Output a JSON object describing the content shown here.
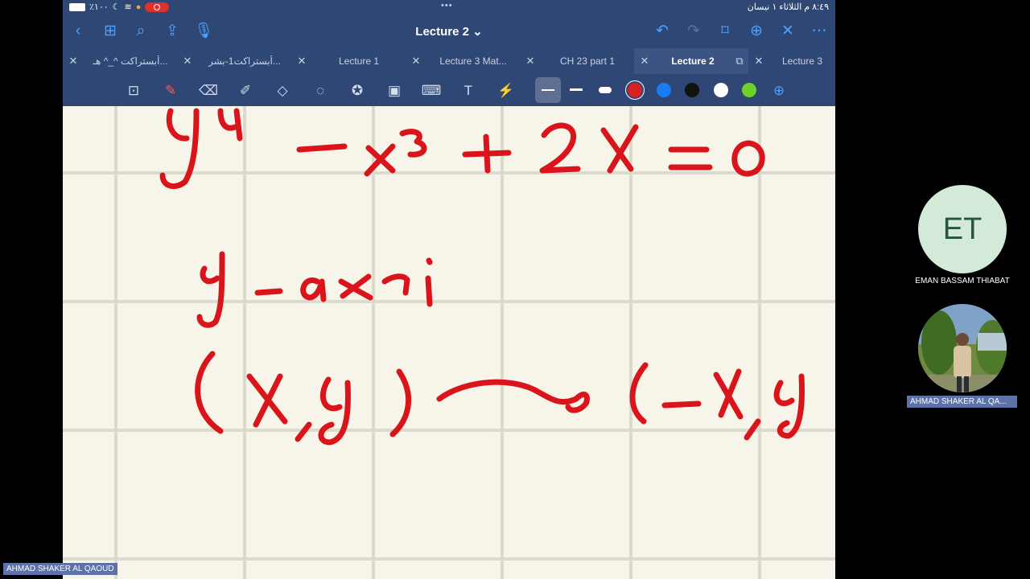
{
  "status_bar": {
    "time_text": "٨:٤٩ م  الثلاثاء ١ نيسان",
    "battery_text": "٪١٠٠"
  },
  "nav": {
    "title": "Lecture 2 ⌄",
    "icons": [
      "back-icon",
      "grid-icon",
      "search-icon",
      "share-icon",
      "mic-icon",
      "undo-icon",
      "redo-icon",
      "bookmark-icon",
      "add-page-icon",
      "close-icon",
      "more-icon"
    ]
  },
  "tabs": [
    {
      "label": "أبستراكت ^_^ هـ...",
      "active": false
    },
    {
      "label": "أبستراكت1-بشر...",
      "active": false
    },
    {
      "label": "Lecture 1",
      "active": false
    },
    {
      "label": "Lecture 3 Mat...",
      "active": false
    },
    {
      "label": "CH 23 part 1",
      "active": false
    },
    {
      "label": "Lecture 2",
      "active": true
    },
    {
      "label": "Lecture 3",
      "active": false
    }
  ],
  "toolbar": {
    "tools": [
      "zoom-window-icon",
      "pen-icon",
      "eraser-icon",
      "highlighter-icon",
      "shapes-icon",
      "lasso-icon",
      "sticker-icon",
      "image-icon",
      "keyboard-icon",
      "text-icon",
      "laser-pointer-icon"
    ],
    "colors": [
      "#d9201e",
      "#1a7cf2",
      "#111111",
      "#ffffff",
      "#6fd12a"
    ]
  },
  "participants": [
    {
      "initials": "ET",
      "name": "EMAN BASSAM THIABAT"
    },
    {
      "name": "AHMAD SHAKER AL QA..."
    }
  ],
  "bottom_name": "AHMAD SHAKER AL QAOUD"
}
